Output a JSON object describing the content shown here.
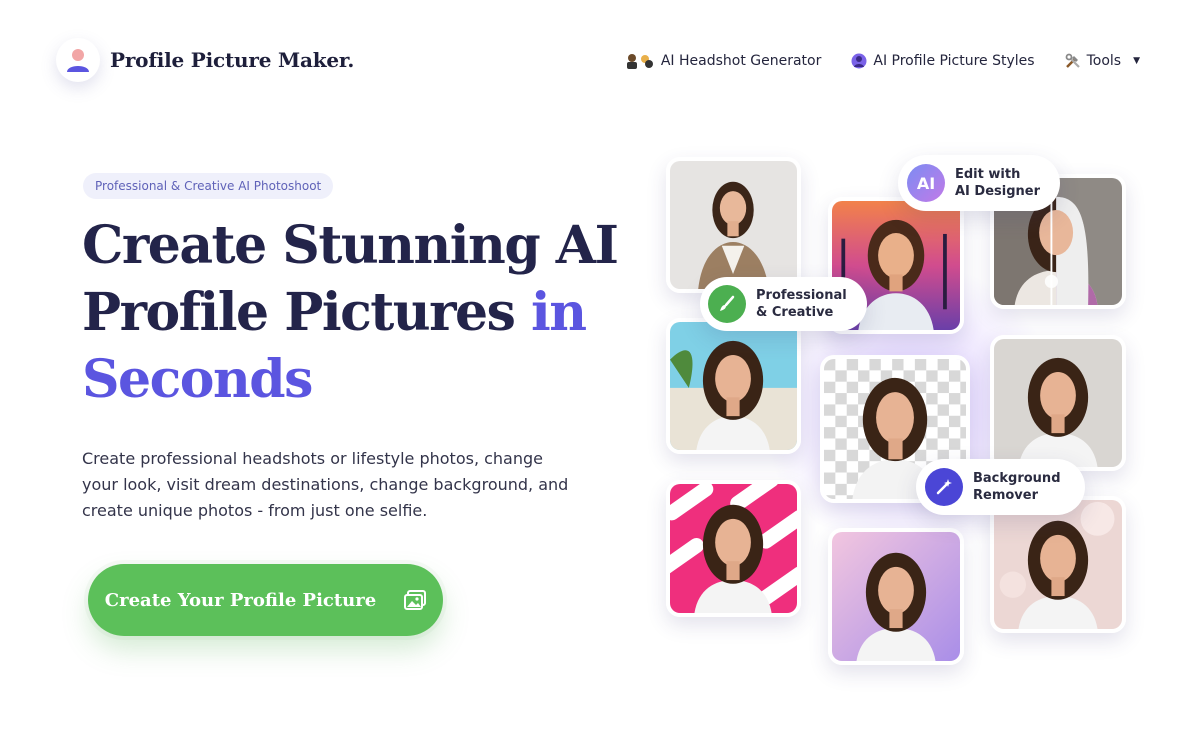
{
  "header": {
    "brand": "Profile Picture Maker.",
    "nav": [
      {
        "label": "AI Headshot Generator",
        "icon": "people-icon"
      },
      {
        "label": "AI Profile Picture Styles",
        "icon": "avatar-icon"
      },
      {
        "label": "Tools",
        "icon": "tools-icon"
      }
    ]
  },
  "hero": {
    "tag": "Professional & Creative AI Photoshoot",
    "headline_line1": "Create Stunning AI",
    "headline_line2": "Profile Pictures",
    "headline_accent1": "in",
    "headline_accent2": "Seconds",
    "description": "Create professional headshots or lifestyle photos, change your look, visit dream destinations, change background, and create unique photos - from just one selfie.",
    "cta_label": "Create Your Profile Picture"
  },
  "collage": {
    "badges": [
      {
        "line1": "Edit with",
        "line2": "AI Designer",
        "icon_text": "AI"
      },
      {
        "line1": "Professional",
        "line2": "& Creative",
        "icon": "brush-icon"
      },
      {
        "line1": "Background",
        "line2": "Remover",
        "icon": "magic-wand-icon"
      }
    ]
  },
  "colors": {
    "accent": "#5b55e0",
    "cta": "#5cc05a",
    "heading": "#23244a"
  }
}
